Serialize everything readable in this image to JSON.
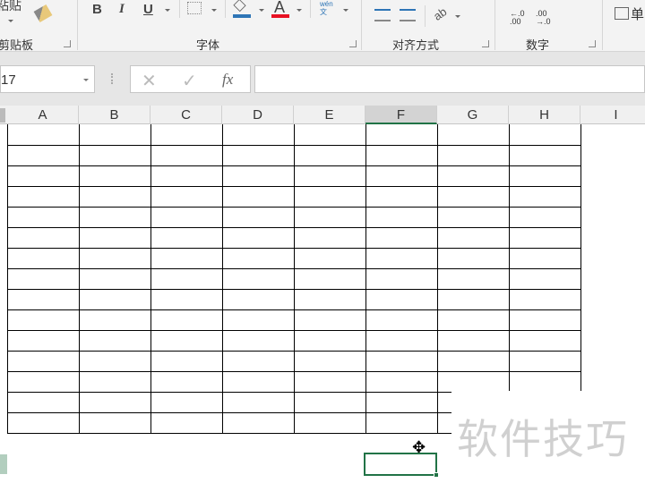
{
  "ribbon": {
    "paste_label": "粘贴",
    "groups": {
      "clipboard": "剪贴板",
      "font": "字体",
      "alignment": "对齐方式",
      "number": "数字",
      "cells_partial": "单"
    },
    "bold": "B",
    "italic": "I",
    "underline": "U",
    "font_color": "A",
    "phonetic": "wén\n文",
    "decimal_increase": "←.0\n.00",
    "decimal_decrease": ".00\n→.0"
  },
  "formula_bar": {
    "name_box": "17",
    "cancel": "✕",
    "enter": "✓",
    "fx": "fx",
    "value": ""
  },
  "sheet": {
    "columns": [
      "A",
      "B",
      "C",
      "D",
      "E",
      "F",
      "G",
      "H",
      "I"
    ],
    "selected_column": "F",
    "row_count": 15
  },
  "watermark": "软件技巧",
  "colors": {
    "accent": "#217346",
    "font_red": "#e81123",
    "fill_blue": "#2e75b6"
  }
}
